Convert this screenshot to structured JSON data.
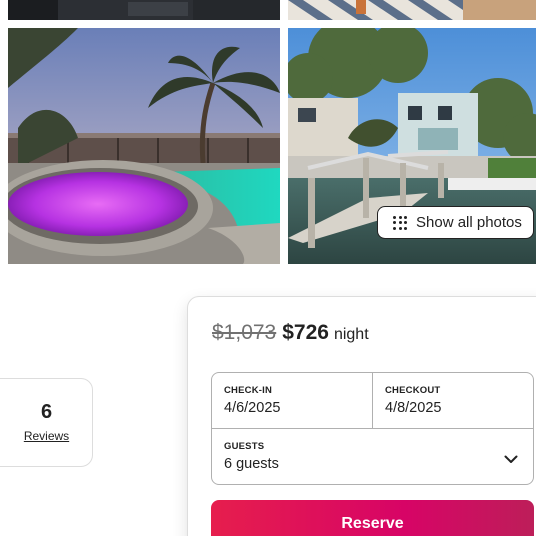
{
  "photos": {
    "top_left": {
      "icon": "house-photo-top"
    },
    "top_right": {
      "icon": "patio-photo-top"
    },
    "pool": {
      "icon": "pool-hot-tub-photo"
    },
    "dock": {
      "icon": "boat-dock-photo"
    },
    "show_all_label": "Show all photos"
  },
  "reviews": {
    "count": "6",
    "label": "Reviews"
  },
  "booking": {
    "original_price": "$1,073",
    "price": "$726",
    "price_unit": "night",
    "checkin_label": "CHECK-IN",
    "checkin_value": "4/6/2025",
    "checkout_label": "CHECKOUT",
    "checkout_value": "4/8/2025",
    "guests_label": "GUESTS",
    "guests_value": "6 guests",
    "reserve_label": "Reserve"
  },
  "colors": {
    "brand": "#e61e4d",
    "text": "#222222",
    "muted": "#717171",
    "border": "#dddddd"
  }
}
